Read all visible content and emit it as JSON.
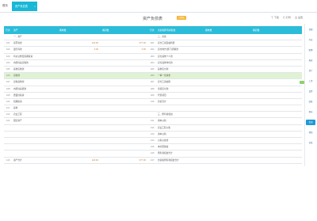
{
  "tabs": {
    "home": "首页",
    "active": "资产负债表",
    "close": "×"
  },
  "header": {
    "title": "资产负债表",
    "badge": "已审核"
  },
  "toolbar": [
    {
      "icon": "下",
      "label": "下载"
    },
    {
      "icon": "打",
      "label": "打印"
    },
    {
      "icon": "设",
      "label": "设置"
    }
  ],
  "table": {
    "columns": [
      "行次",
      "资产",
      "期末数",
      "期初数",
      "行次",
      "负债和所有者权益",
      "期末数",
      "期初数"
    ],
    "rows": [
      {
        "l1": "",
        "a": "一、资产",
        "e": "",
        "b": "",
        "l2": "",
        "c": "二、负债",
        "d1": "",
        "d2": ""
      },
      {
        "l1": "101",
        "a": "货币资金",
        "e": "120.00",
        "b": "377.00",
        "l2": "201",
        "c": "应付工资及福利费",
        "d1": "",
        "d2": ""
      },
      {
        "l1": "102",
        "a": "银行存款",
        "e": "0.00",
        "b": "0.00",
        "l2": "202",
        "c": "应付地方(部门)调拨款",
        "d1": "",
        "d2": ""
      },
      {
        "l1": "103",
        "a": "有价证券及短期投资",
        "e": "",
        "b": "",
        "l2": "203",
        "c": "应付其他个人款",
        "d1": "",
        "d2": ""
      },
      {
        "l1": "104",
        "a": "内部往来应收款",
        "e": "",
        "b": "",
        "l2": "204",
        "c": "应付其他单位款",
        "d1": "",
        "d2": ""
      },
      {
        "l1": "105",
        "a": "其他应收款",
        "e": "",
        "b": "",
        "l2": "205",
        "c": "其他应付款",
        "d1": "",
        "d2": ""
      },
      {
        "l1": "106",
        "a": "应收款",
        "e": "",
        "b": "",
        "l2": "206",
        "c": "一事一议资金",
        "d1": "",
        "d2": ""
      },
      {
        "l1": "107",
        "a": "应收其他款",
        "e": "",
        "b": "",
        "l2": "207",
        "c": "应付工资福利",
        "d1": "",
        "d2": ""
      },
      {
        "l1": "108",
        "a": "内部往来借款",
        "e": "",
        "b": "",
        "l2": "208",
        "c": "专项应付款",
        "d1": "",
        "d2": ""
      },
      {
        "l1": "109",
        "a": "農業性投资",
        "e": "",
        "b": "",
        "l2": "209",
        "c": "代管项目",
        "d1": "",
        "d2": ""
      },
      {
        "l1": "110",
        "a": "短期投资",
        "e": "",
        "b": "",
        "l2": "210",
        "c": "负债合计",
        "d1": "",
        "d2": ""
      },
      {
        "l1": "111",
        "a": "其他",
        "e": "",
        "b": "",
        "l2": "",
        "c": "",
        "d1": "",
        "d2": ""
      },
      {
        "l1": "112",
        "a": "农业工程",
        "e": "",
        "b": "",
        "l2": "",
        "c": "三、所有者权益",
        "d1": "",
        "d2": ""
      },
      {
        "l1": "113",
        "a": "固定资产",
        "e": "",
        "b": "",
        "l2": "211",
        "c": "资本公积",
        "d1": "",
        "d2": ""
      },
      {
        "l1": "",
        "a": "",
        "e": "",
        "b": "",
        "l2": "212",
        "c": "农业工程公积",
        "d1": "",
        "d2": ""
      },
      {
        "l1": "",
        "a": "",
        "e": "",
        "b": "",
        "l2": "213",
        "c": "资本公积",
        "d1": "",
        "d2": ""
      },
      {
        "l1": "",
        "a": "",
        "e": "",
        "b": "",
        "l2": "214",
        "c": "公积公益金",
        "d1": "",
        "d2": ""
      },
      {
        "l1": "",
        "a": "",
        "e": "",
        "b": "",
        "l2": "215",
        "c": "未分配收益",
        "d1": "",
        "d2": ""
      },
      {
        "l1": "",
        "a": "",
        "e": "",
        "b": "",
        "l2": "216",
        "c": "所有者权益合计",
        "d1": "",
        "d2": ""
      },
      {
        "l1": "120",
        "a": "资产合计",
        "e": "120.00",
        "b": "377.00",
        "l2": "217",
        "c": "负债和所有者权益合计",
        "d1": "",
        "d2": ""
      }
    ],
    "highlight_row": 6
  },
  "sidepanel": [
    "快捷",
    "凭证",
    "账簿",
    "报表",
    "资产",
    "工资",
    "设置",
    "结账",
    "期末",
    "查询",
    "帮助",
    "系统"
  ],
  "sidepanel_active": 9
}
